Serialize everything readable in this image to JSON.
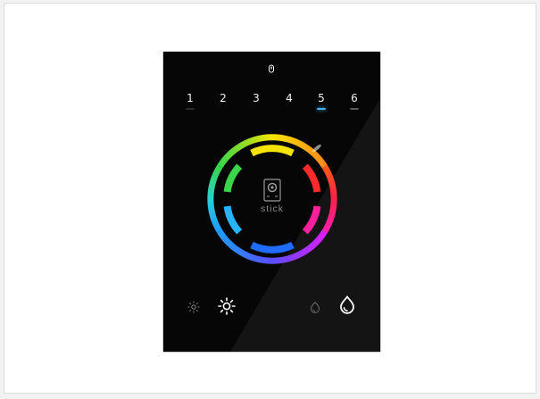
{
  "panel": {
    "zones": [
      {
        "label": "1",
        "indicator": "#2a2a2a"
      },
      {
        "label": "2",
        "indicator": "#060606"
      },
      {
        "label": "3",
        "indicator": "#060606"
      },
      {
        "label": "4",
        "indicator": "#060606"
      },
      {
        "label": "5",
        "indicator": "#3fb4f0"
      },
      {
        "label": "6",
        "indicator": "#5a5a5a"
      }
    ],
    "brand": "stick",
    "icons": {
      "power": "power-icon",
      "brightness_down": "sun-small-icon",
      "brightness_up": "sun-large-icon",
      "color_off": "color-drop-dim-icon",
      "color_on": "color-drop-icon"
    },
    "colors": {
      "body": "#060606",
      "ring_yellow": "#f5e400",
      "ring_red": "#ff2b2b",
      "ring_magenta": "#ff1f9e",
      "ring_blue": "#1f6cff",
      "ring_cyan": "#27b4ff",
      "ring_green": "#39d64a"
    }
  }
}
